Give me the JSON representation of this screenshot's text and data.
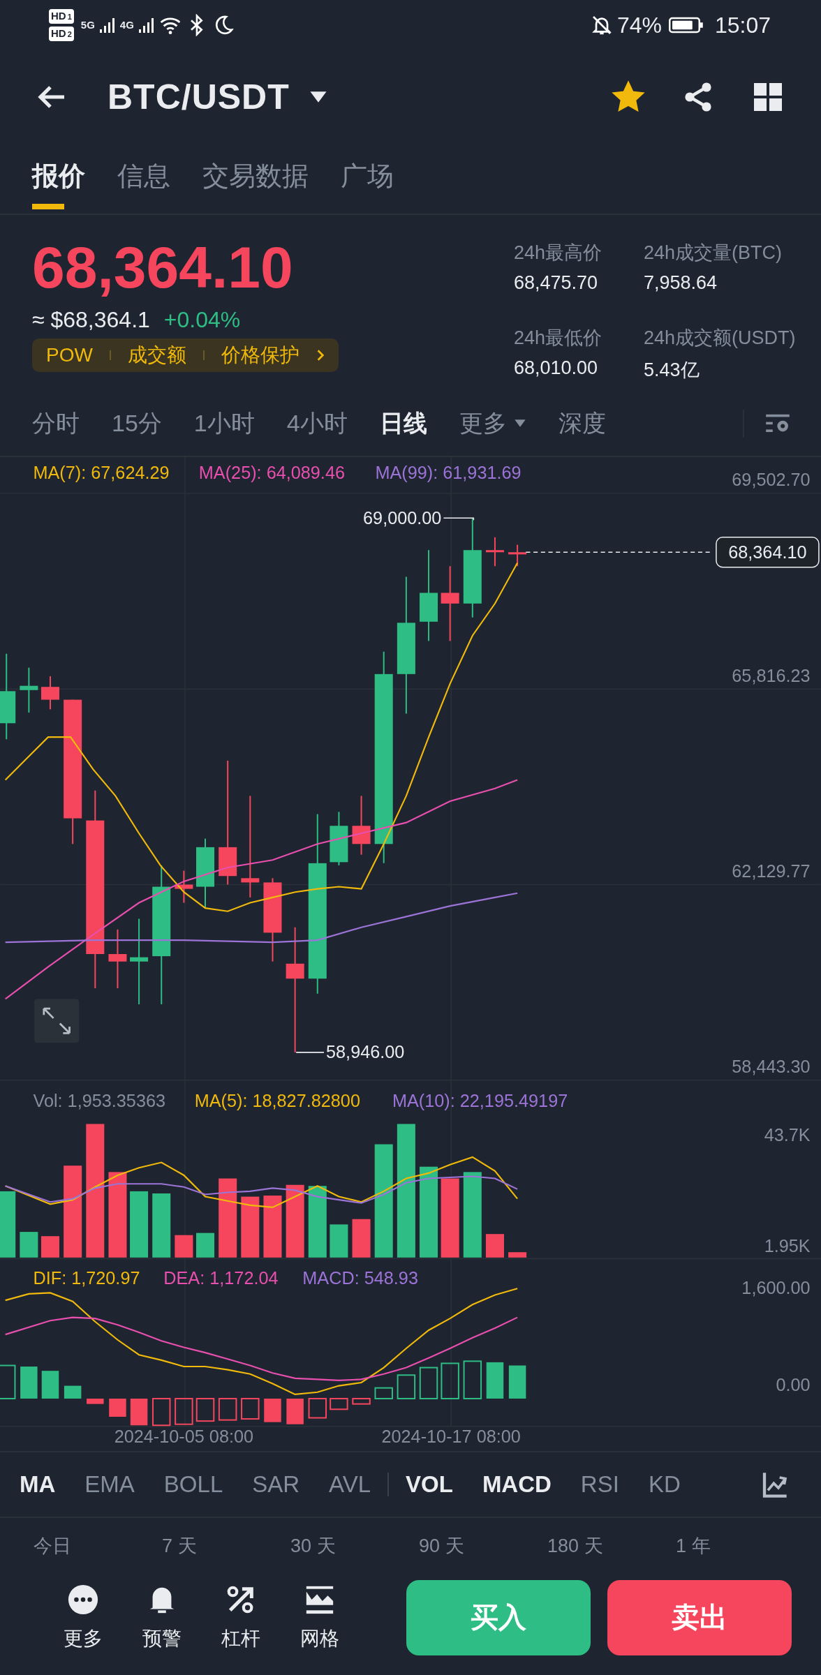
{
  "status_bar": {
    "sims": [
      {
        "hd": "HD",
        "slot": "1",
        "tech": "5G"
      },
      {
        "hd": "HD",
        "slot": "2",
        "tech": "4G"
      }
    ],
    "battery": "74%",
    "time": "15:07"
  },
  "header": {
    "title": "BTC/USDT",
    "favorite": true
  },
  "tabs": [
    {
      "label": "报价",
      "selected": true
    },
    {
      "label": "信息",
      "selected": false
    },
    {
      "label": "交易数据",
      "selected": false
    },
    {
      "label": "广场",
      "selected": false
    }
  ],
  "price": {
    "last": "68,364.10",
    "fiat": "≈ $68,364.1",
    "change": "+0.04%",
    "tags": [
      "POW",
      "成交额",
      "价格保护"
    ]
  },
  "stats": [
    {
      "label": "24h最高价",
      "value": "68,475.70"
    },
    {
      "label": "24h成交量(BTC)",
      "value": "7,958.64"
    },
    {
      "label": "24h最低价",
      "value": "68,010.00"
    },
    {
      "label": "24h成交额(USDT)",
      "value": "5.43亿"
    }
  ],
  "intervals": [
    {
      "label": "分时",
      "selected": false,
      "kind": "option"
    },
    {
      "label": "15分",
      "selected": false,
      "kind": "option"
    },
    {
      "label": "1小时",
      "selected": false,
      "kind": "option"
    },
    {
      "label": "4小时",
      "selected": false,
      "kind": "option"
    },
    {
      "label": "日线",
      "selected": true,
      "kind": "option"
    },
    {
      "label": "更多",
      "selected": false,
      "kind": "dropdown"
    },
    {
      "label": "深度",
      "selected": false,
      "kind": "option"
    }
  ],
  "chart": {
    "ma_legend": [
      {
        "label": "MA(7): 67,624.29",
        "color": "#f0b90b"
      },
      {
        "label": "MA(25): 64,089.46",
        "color": "#e84fae"
      },
      {
        "label": "MA(99): 61,931.69",
        "color": "#9c74d8"
      }
    ],
    "price_ticks": [
      "69,502.70",
      "65,816.23",
      "62,129.77",
      "58,443.30"
    ],
    "current_price": "68,364.10",
    "high_label": "69,000.00",
    "low_label": "58,946.00",
    "vol_legend": [
      {
        "label": "Vol: 1,953.35363",
        "color": "#848e9c"
      },
      {
        "label": "MA(5): 18,827.82800",
        "color": "#f0b90b"
      },
      {
        "label": "MA(10): 22,195.49197",
        "color": "#9c74d8"
      }
    ],
    "vol_ticks": [
      "43.7K",
      "1.95K"
    ],
    "macd_legend": [
      {
        "label": "DIF: 1,720.97",
        "color": "#f0b90b"
      },
      {
        "label": "DEA: 1,172.04",
        "color": "#e84fae"
      },
      {
        "label": "MACD: 548.93",
        "color": "#9c74d8"
      }
    ],
    "macd_ticks": [
      "1,600.00",
      "0.00"
    ],
    "dates": [
      "2024-10-05 08:00",
      "2024-10-17 08:00"
    ]
  },
  "indicators": [
    {
      "label": "MA",
      "selected": true
    },
    {
      "label": "EMA",
      "selected": false
    },
    {
      "label": "BOLL",
      "selected": false
    },
    {
      "label": "SAR",
      "selected": false
    },
    {
      "label": "AVL",
      "selected": false
    },
    {
      "label": "VOL",
      "selected": true
    },
    {
      "label": "MACD",
      "selected": true
    },
    {
      "label": "RSI",
      "selected": false
    },
    {
      "label": "KD",
      "selected": false
    }
  ],
  "ranges": [
    "今日",
    "7 天",
    "30 天",
    "90 天",
    "180 天",
    "1 年"
  ],
  "actions": [
    {
      "label": "更多",
      "kind": "more"
    },
    {
      "label": "预警",
      "kind": "alert"
    },
    {
      "label": "杠杆",
      "kind": "leverage"
    },
    {
      "label": "网格",
      "kind": "grid"
    }
  ],
  "buy": "买入",
  "sell": "卖出"
}
